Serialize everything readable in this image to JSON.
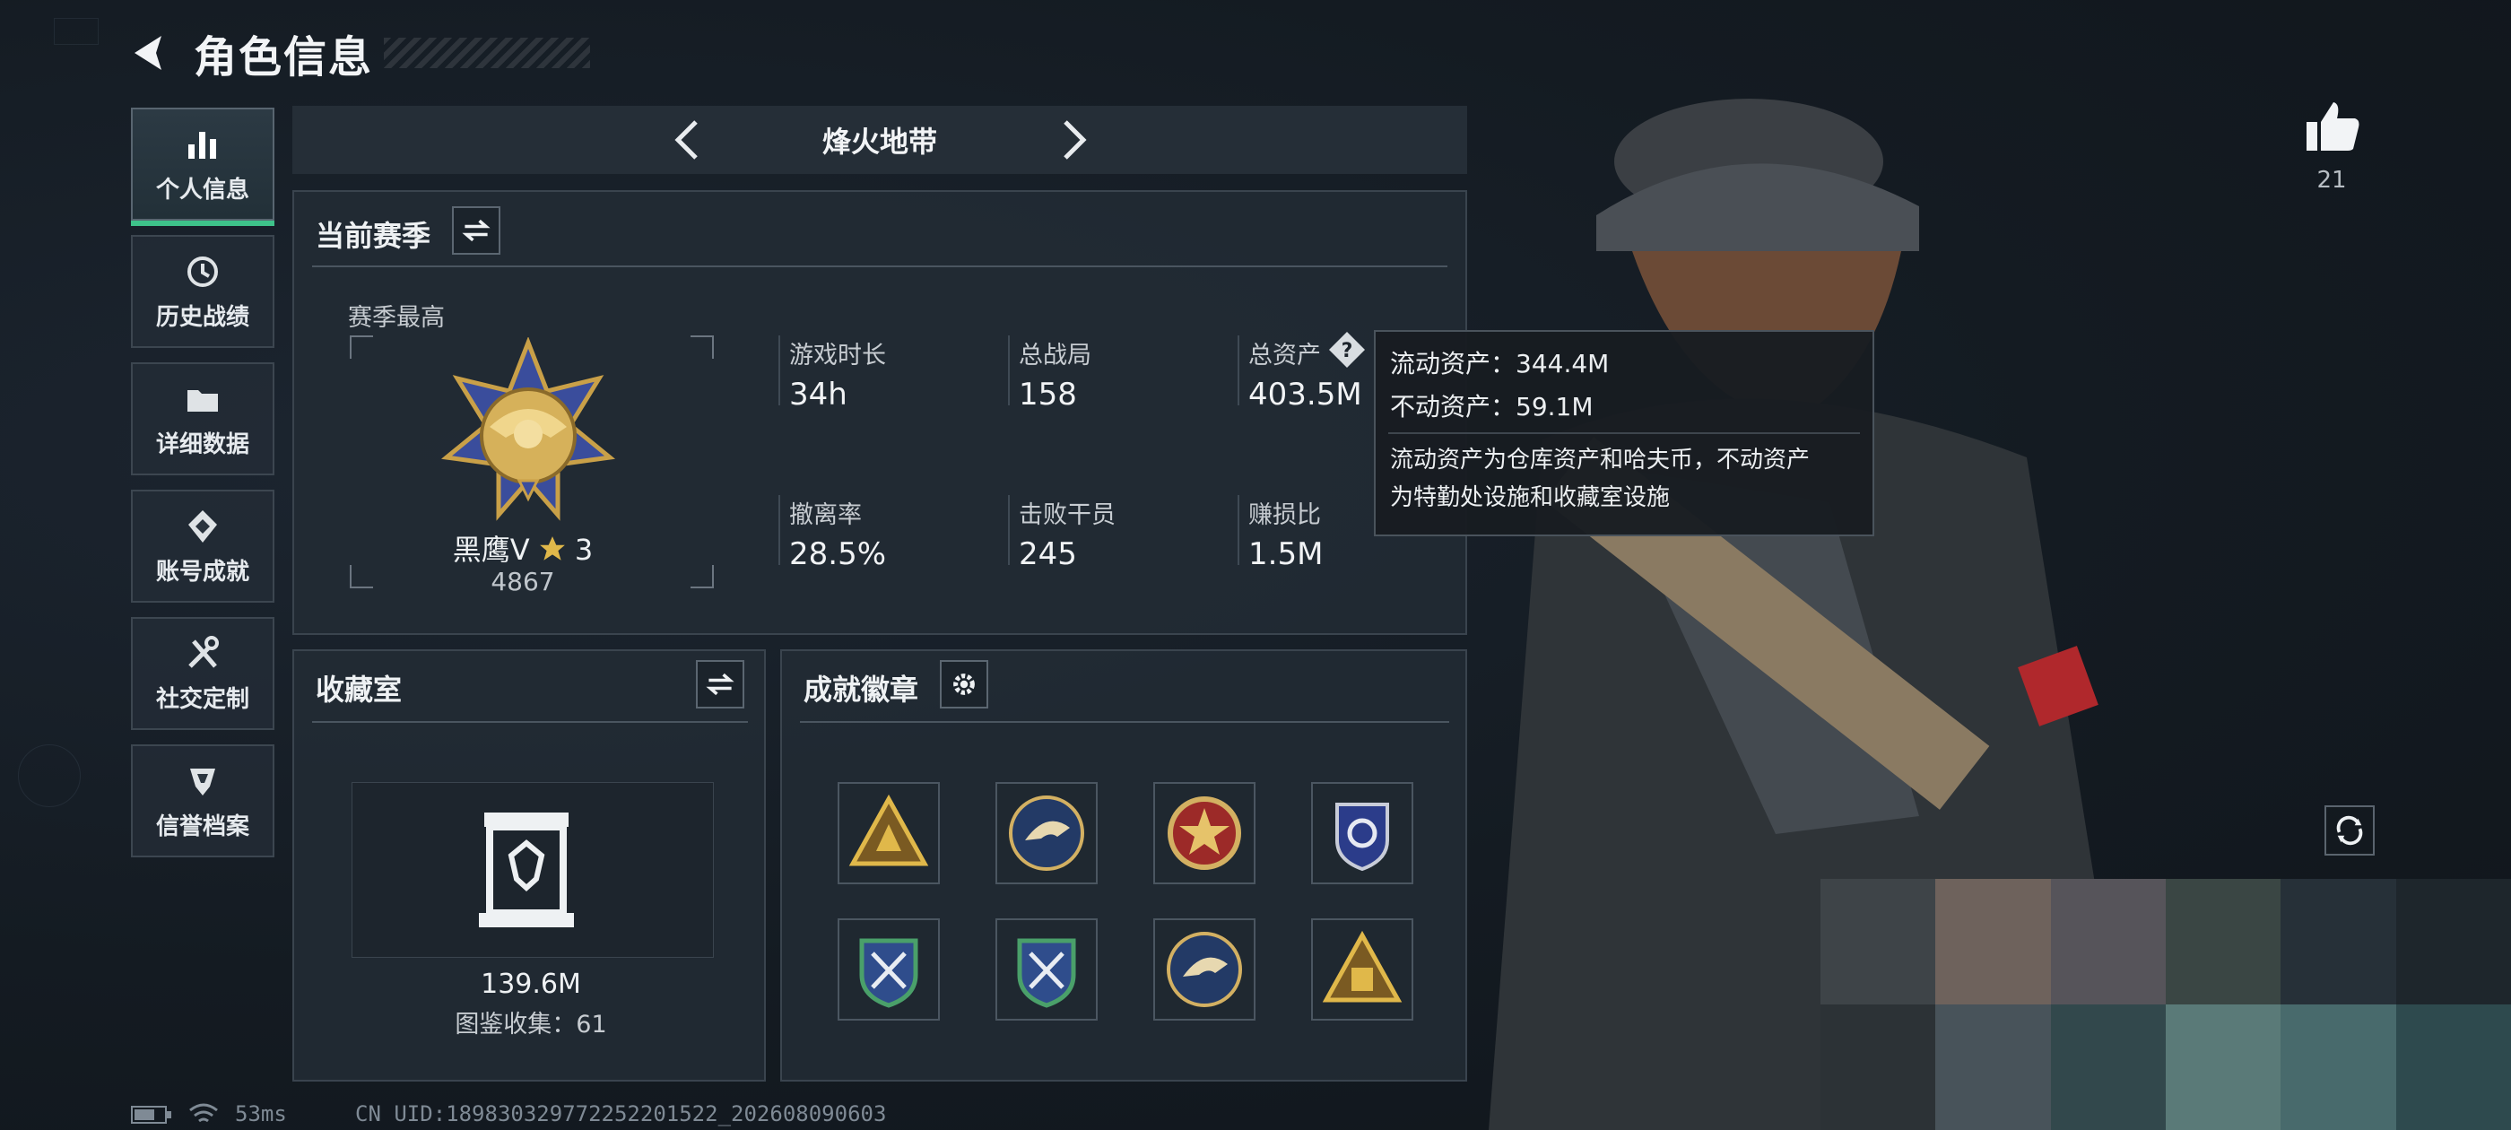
{
  "header": {
    "title": "角色信息"
  },
  "nav": [
    {
      "label": "个人信息",
      "icon": "bar-chart-icon",
      "active": true
    },
    {
      "label": "历史战绩",
      "icon": "history-icon"
    },
    {
      "label": "详细数据",
      "icon": "folder-icon"
    },
    {
      "label": "账号成就",
      "icon": "achievement-icon"
    },
    {
      "label": "社交定制",
      "icon": "tools-icon"
    },
    {
      "label": "信誉档案",
      "icon": "shield-icon"
    }
  ],
  "mode_tab": {
    "title": "烽火地带"
  },
  "season": {
    "title": "当前赛季",
    "best_label": "赛季最高",
    "rank_name": "黑鹰Ⅴ",
    "rank_stars": "3",
    "rank_score": "4867",
    "stats": [
      {
        "label": "游戏时长",
        "value": "34h"
      },
      {
        "label": "总战局",
        "value": "158"
      },
      {
        "label": "总资产",
        "value": "403.5M"
      },
      {
        "label": "撤离率",
        "value": "28.5%"
      },
      {
        "label": "击败干员",
        "value": "245"
      },
      {
        "label": "赚损比",
        "value": "1.5M"
      }
    ]
  },
  "tooltip": {
    "liquid": "流动资产：344.4M",
    "fixed": "不动资产：59.1M",
    "desc_line1": "流动资产为仓库资产和哈夫币，不动资产",
    "desc_line2": "为特勤处设施和收藏室设施"
  },
  "collection": {
    "title": "收藏室",
    "value": "139.6M",
    "count_text": "图鉴收集：61"
  },
  "achievements": {
    "title": "成就徽章",
    "badges": [
      "triangle-badge-icon",
      "eagle-badge-icon",
      "star-badge-icon",
      "shield-badge-icon",
      "crossed-arrows-badge-icon",
      "crossed-arrows-badge-icon",
      "eagle-badge-icon",
      "squad-badge-icon"
    ]
  },
  "like": {
    "count": "21"
  },
  "status": {
    "ping": "53ms",
    "uid": "CN UID:18983032977225220152​2_202608090603"
  },
  "colors": {
    "accent_green": "#3ec28a",
    "panel": "#222b34",
    "gold": "#c9a048"
  }
}
